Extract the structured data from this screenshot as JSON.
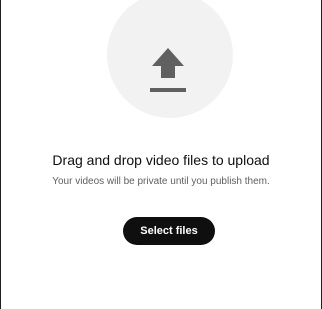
{
  "upload": {
    "icon": "upload-arrow-icon",
    "headline": "Drag and drop video files to upload",
    "subtext": "Your videos will be private until you publish them.",
    "button_label": "Select files"
  },
  "colors": {
    "circle_bg": "#f2f2f2",
    "icon": "#606060",
    "button_bg": "#0f0f0f",
    "button_text": "#ffffff",
    "headline": "#0f0f0f",
    "subtext": "#606060"
  }
}
